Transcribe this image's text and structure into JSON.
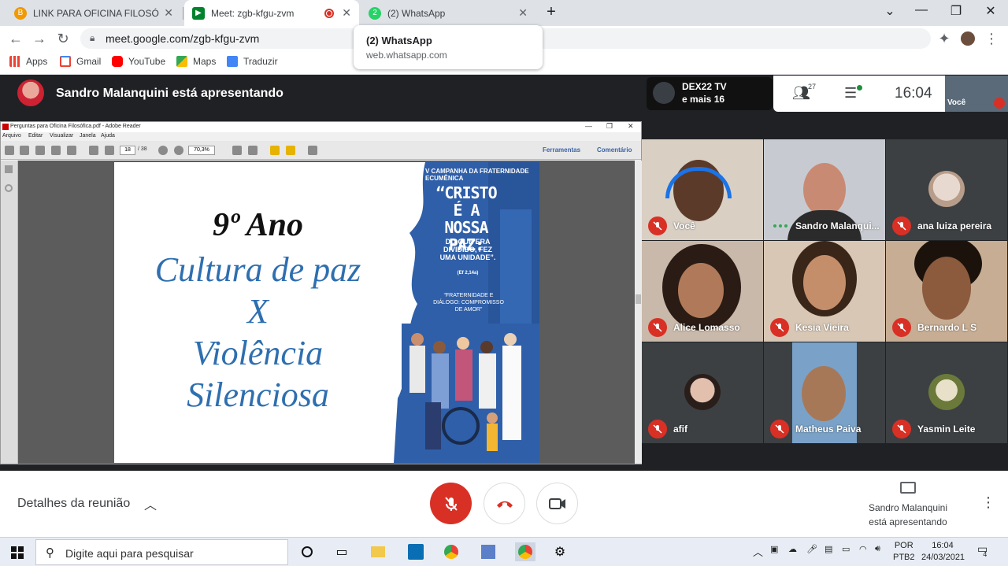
{
  "browser": {
    "tabs": [
      {
        "title": "LINK PARA OFICINA FILOSÓFICA",
        "active": false
      },
      {
        "title": "Meet: zgb-kfgu-zvm",
        "active": true
      },
      {
        "title": "(2) WhatsApp",
        "active": false
      }
    ],
    "new_tab_label": "+",
    "url": "meet.google.com/zgb-kfgu-zvm",
    "bookmarks": [
      {
        "label": "Apps",
        "icon": "apps-grid-icon"
      },
      {
        "label": "Gmail",
        "icon": "gmail-icon"
      },
      {
        "label": "YouTube",
        "icon": "youtube-icon"
      },
      {
        "label": "Maps",
        "icon": "maps-icon"
      },
      {
        "label": "Traduzir",
        "icon": "translate-icon"
      }
    ],
    "hover_card": {
      "title": "(2) WhatsApp",
      "domain": "web.whatsapp.com"
    }
  },
  "meet": {
    "presenting_banner": "Sandro Malanquini está apresentando",
    "host_box": {
      "line1": "DEX22 TV",
      "line2": "e mais 16"
    },
    "participant_count": "27",
    "clock": "16:04",
    "self_label": "Você",
    "tiles": [
      {
        "name": "Você",
        "muted": true
      },
      {
        "name": "Sandro Malanqui...",
        "muted": false,
        "speaking": true
      },
      {
        "name": "ana luiza pereira",
        "muted": true
      },
      {
        "name": "Alice Lomasso",
        "muted": true
      },
      {
        "name": "Kesia Vieira",
        "muted": true
      },
      {
        "name": "Bernardo L S",
        "muted": true
      },
      {
        "name": "afif",
        "muted": true
      },
      {
        "name": "Matheus Paiva",
        "muted": true
      },
      {
        "name": "Yasmin Leite",
        "muted": true
      }
    ],
    "meeting_details": "Detalhes da reunião",
    "presenter_line1": "Sandro Malanquini",
    "presenter_line2": "está apresentando",
    "colors": {
      "red": "#d93025",
      "bg": "#202124"
    }
  },
  "pdf": {
    "window_title": "Perguntas para Oficina Filosófica.pdf - Adobe Reader",
    "menu": [
      "Arquivo",
      "Editar",
      "Visualizar",
      "Janela",
      "Ajuda"
    ],
    "page_current": "18",
    "page_total": "/ 38",
    "zoom": "70,3%",
    "tools_link": "Ferramentas",
    "comment_link": "Comentário",
    "slide": {
      "heading": "9º Ano",
      "lines": [
        "Cultura de paz",
        "X",
        "Violência",
        "Silenciosa"
      ],
      "poster_top": "V CAMPANHA DA FRATERNIDADE ECUMÊNICA",
      "poster_title": "“CRISTO É A NOSSA PAZ:",
      "poster_subtitle": "DO QUE ERA DIVIDIDO, FEZ UMA UNIDADE”.",
      "poster_ref": "(Ef 2,14a)",
      "poster_theme": "“FRATERNIDADE E DIÁLOGO: COMPROMISSO DE AMOR”"
    }
  },
  "taskbar": {
    "search_placeholder": "Digite aqui para pesquisar",
    "lang1": "POR",
    "lang2": "PTB2",
    "time": "16:04",
    "date": "24/03/2021",
    "notifications": "4"
  }
}
